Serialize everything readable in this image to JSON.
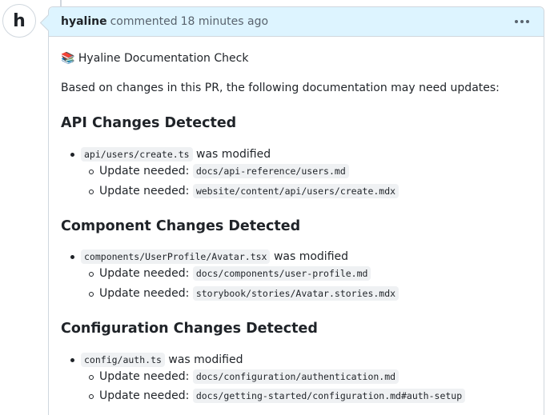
{
  "avatar": {
    "letter": "h"
  },
  "comment": {
    "author": "hyaline",
    "action": "commented",
    "time": "18 minutes ago"
  },
  "content": {
    "check_title": "📚 Hyaline Documentation Check",
    "intro": "Based on changes in this PR, the following documentation may need updates:",
    "sections": [
      {
        "heading": "API Changes Detected",
        "file": "api/users/create.ts",
        "modified": "was modified",
        "updates": [
          {
            "label": "Update needed:",
            "path": "docs/api-reference/users.md"
          },
          {
            "label": "Update needed:",
            "path": "website/content/api/users/create.mdx"
          }
        ]
      },
      {
        "heading": "Component Changes Detected",
        "file": "components/UserProfile/Avatar.tsx",
        "modified": "was modified",
        "updates": [
          {
            "label": "Update needed:",
            "path": "docs/components/user-profile.md"
          },
          {
            "label": "Update needed:",
            "path": "storybook/stories/Avatar.stories.mdx"
          }
        ]
      },
      {
        "heading": "Configuration Changes Detected",
        "file": "config/auth.ts",
        "modified": "was modified",
        "updates": [
          {
            "label": "Update needed:",
            "path": "docs/configuration/authentication.md"
          },
          {
            "label": "Update needed:",
            "path": "docs/getting-started/configuration.md#auth-setup"
          }
        ]
      }
    ]
  }
}
